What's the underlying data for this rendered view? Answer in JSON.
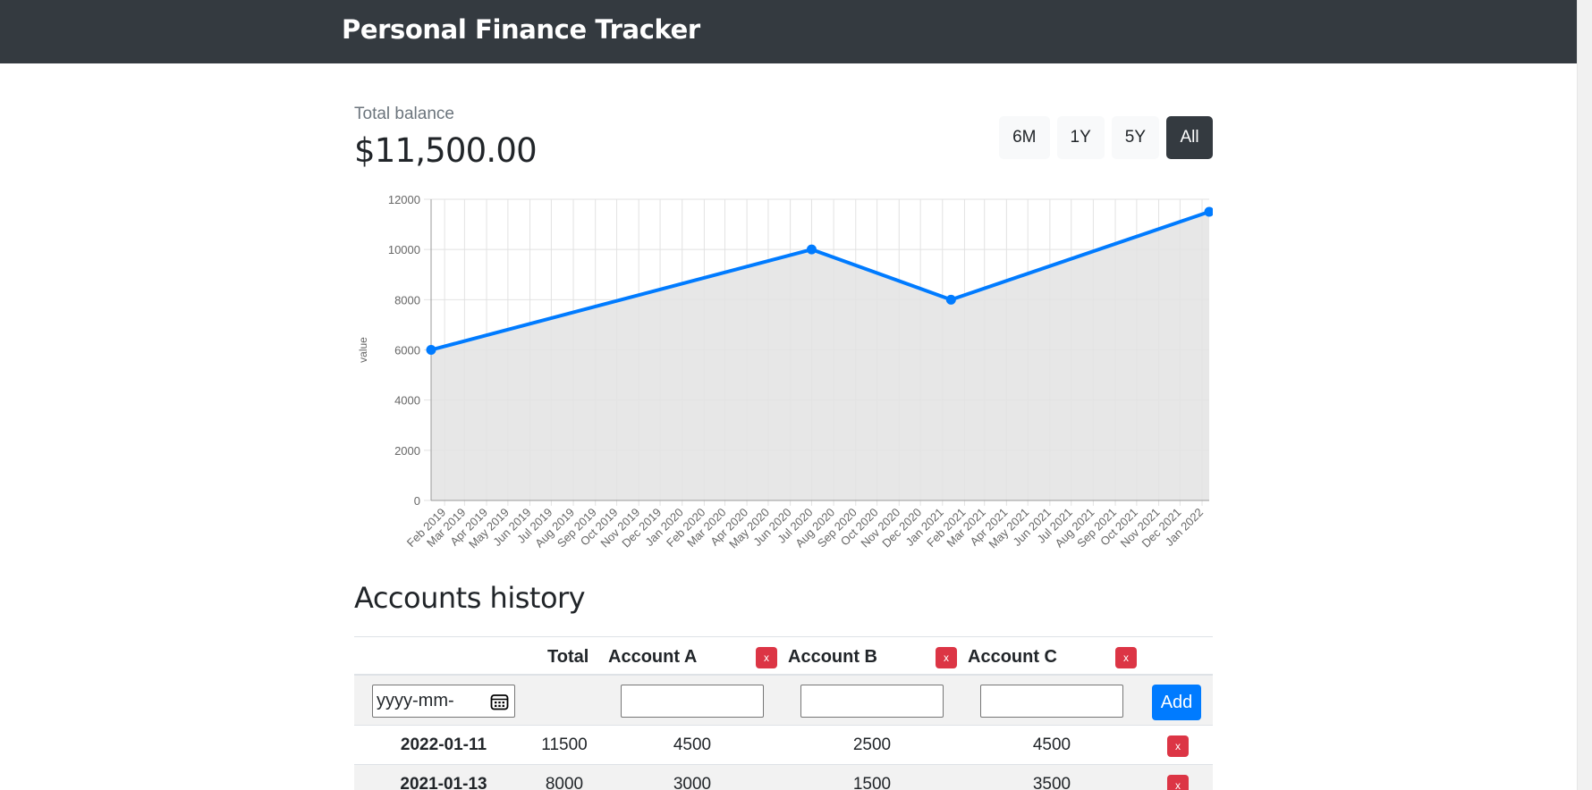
{
  "app": {
    "title": "Personal Finance Tracker"
  },
  "balance": {
    "label": "Total balance",
    "value": "$11,500.00"
  },
  "range_buttons": [
    {
      "label": "6M",
      "active": false
    },
    {
      "label": "1Y",
      "active": false
    },
    {
      "label": "5Y",
      "active": false
    },
    {
      "label": "All",
      "active": true
    }
  ],
  "chart_data": {
    "type": "area",
    "x": [
      "2019-01-13",
      "2020-07-01",
      "2021-01-13",
      "2022-01-11"
    ],
    "y": [
      6000,
      10000,
      8000,
      11500
    ],
    "ylabel": "value",
    "ylim": [
      0,
      12000
    ],
    "yticks": [
      0,
      2000,
      4000,
      6000,
      8000,
      10000,
      12000
    ],
    "xticks": [
      "Feb 2019",
      "Mar 2019",
      "Apr 2019",
      "May 2019",
      "Jun 2019",
      "Jul 2019",
      "Aug 2019",
      "Sep 2019",
      "Oct 2019",
      "Nov 2019",
      "Dec 2019",
      "Jan 2020",
      "Feb 2020",
      "Mar 2020",
      "Apr 2020",
      "May 2020",
      "Jun 2020",
      "Jul 2020",
      "Aug 2020",
      "Sep 2020",
      "Oct 2020",
      "Nov 2020",
      "Dec 2020",
      "Jan 2021",
      "Feb 2021",
      "Mar 2021",
      "Apr 2021",
      "May 2021",
      "Jun 2021",
      "Jul 2021",
      "Aug 2021",
      "Sep 2021",
      "Oct 2021",
      "Nov 2021",
      "Dec 2021",
      "Jan 2022"
    ],
    "line_color": "#007bff",
    "fill_color": "#e3e3e3",
    "grid": true
  },
  "accounts_history": {
    "title": "Accounts history",
    "headers": {
      "total": "Total",
      "accounts": [
        "Account A",
        "Account B",
        "Account C"
      ]
    },
    "remove_label": "x",
    "date_placeholder": "yyyy-mm-",
    "add_label": "Add",
    "rows": [
      {
        "date": "2022-01-11",
        "total": "11500",
        "values": [
          "4500",
          "2500",
          "4500"
        ]
      },
      {
        "date": "2021-01-13",
        "total": "8000",
        "values": [
          "3000",
          "1500",
          "3500"
        ]
      }
    ]
  },
  "colors": {
    "navbar": "#343a40",
    "primary": "#007bff",
    "danger": "#dc3545"
  }
}
